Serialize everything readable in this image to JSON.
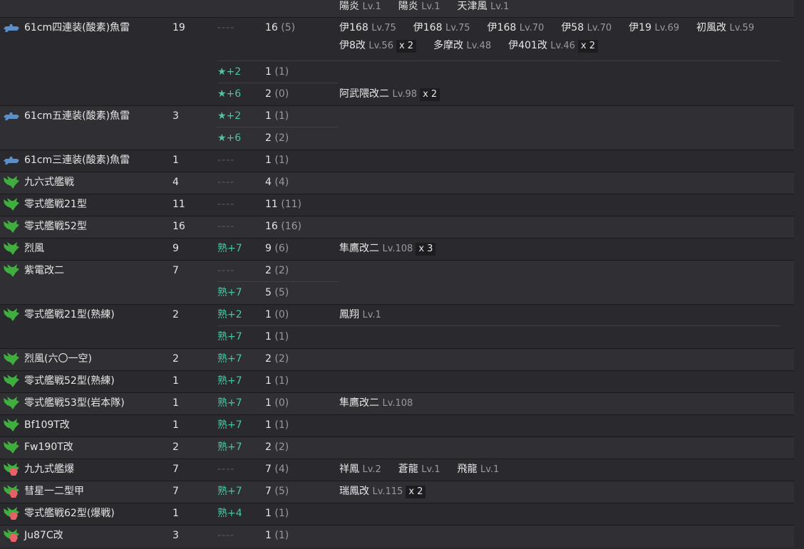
{
  "top_ships": [
    {
      "name": "陽炎",
      "lv": "Lv.1",
      "mult": ""
    },
    {
      "name": "陽炎",
      "lv": "Lv.1",
      "mult": ""
    },
    {
      "name": "天津風",
      "lv": "Lv.1",
      "mult": ""
    }
  ],
  "equipment": [
    {
      "name": "61cm四連装(酸素)魚雷",
      "total": "19",
      "icon": "torpedo-icon",
      "subrows": [
        {
          "level": "----",
          "count": "16",
          "avail": "(5)",
          "ships": [
            [
              {
                "name": "伊168",
                "lv": "Lv.75",
                "mult": ""
              },
              {
                "name": "伊168",
                "lv": "Lv.75",
                "mult": ""
              },
              {
                "name": "伊168",
                "lv": "Lv.70",
                "mult": ""
              },
              {
                "name": "伊58",
                "lv": "Lv.70",
                "mult": ""
              },
              {
                "name": "伊19",
                "lv": "Lv.69",
                "mult": ""
              },
              {
                "name": "初風改",
                "lv": "Lv.59",
                "mult": ""
              }
            ],
            [
              {
                "name": "伊8改",
                "lv": "Lv.56",
                "mult": "x 2"
              },
              {
                "name": "多摩改",
                "lv": "Lv.48",
                "mult": ""
              },
              {
                "name": "伊401改",
                "lv": "Lv.46",
                "mult": "x 2"
              }
            ]
          ]
        },
        {
          "level": "★+2",
          "count": "1",
          "avail": "(1)",
          "ships": []
        },
        {
          "level": "★+6",
          "count": "2",
          "avail": "(0)",
          "ships": [
            [
              {
                "name": "阿武隈改二",
                "lv": "Lv.98",
                "mult": "x 2"
              }
            ]
          ]
        }
      ]
    },
    {
      "name": "61cm五連装(酸素)魚雷",
      "total": "3",
      "icon": "torpedo-icon",
      "subrows": [
        {
          "level": "★+2",
          "count": "1",
          "avail": "(1)",
          "ships": []
        },
        {
          "level": "★+6",
          "count": "2",
          "avail": "(2)",
          "ships": []
        }
      ]
    },
    {
      "name": "61cm三連装(酸素)魚雷",
      "total": "1",
      "icon": "torpedo-icon",
      "subrows": [
        {
          "level": "----",
          "count": "1",
          "avail": "(1)",
          "ships": []
        }
      ]
    },
    {
      "name": "九六式艦戦",
      "total": "4",
      "icon": "fighter-icon",
      "subrows": [
        {
          "level": "----",
          "count": "4",
          "avail": "(4)",
          "ships": []
        }
      ]
    },
    {
      "name": "零式艦戦21型",
      "total": "11",
      "icon": "fighter-icon",
      "subrows": [
        {
          "level": "----",
          "count": "11",
          "avail": "(11)",
          "ships": []
        }
      ]
    },
    {
      "name": "零式艦戦52型",
      "total": "16",
      "icon": "fighter-icon",
      "subrows": [
        {
          "level": "----",
          "count": "16",
          "avail": "(16)",
          "ships": []
        }
      ]
    },
    {
      "name": "烈風",
      "total": "9",
      "icon": "fighter-icon",
      "subrows": [
        {
          "level": "熟+7",
          "count": "9",
          "avail": "(6)",
          "ships": [
            [
              {
                "name": "隼鷹改二",
                "lv": "Lv.108",
                "mult": "x 3"
              }
            ]
          ]
        }
      ]
    },
    {
      "name": "紫電改二",
      "total": "7",
      "icon": "fighter-icon",
      "subrows": [
        {
          "level": "----",
          "count": "2",
          "avail": "(2)",
          "ships": []
        },
        {
          "level": "熟+7",
          "count": "5",
          "avail": "(5)",
          "ships": []
        }
      ]
    },
    {
      "name": "零式艦戦21型(熟練)",
      "total": "2",
      "icon": "fighter-icon",
      "subrows": [
        {
          "level": "熟+2",
          "count": "1",
          "avail": "(0)",
          "ships": [
            [
              {
                "name": "鳳翔",
                "lv": "Lv.1",
                "mult": ""
              }
            ]
          ]
        },
        {
          "level": "熟+7",
          "count": "1",
          "avail": "(1)",
          "ships": []
        }
      ]
    },
    {
      "name": "烈風(六〇一空)",
      "total": "2",
      "icon": "fighter-icon",
      "subrows": [
        {
          "level": "熟+7",
          "count": "2",
          "avail": "(2)",
          "ships": []
        }
      ]
    },
    {
      "name": "零式艦戦52型(熟練)",
      "total": "1",
      "icon": "fighter-icon",
      "subrows": [
        {
          "level": "熟+7",
          "count": "1",
          "avail": "(1)",
          "ships": []
        }
      ]
    },
    {
      "name": "零式艦戦53型(岩本隊)",
      "total": "1",
      "icon": "fighter-icon",
      "subrows": [
        {
          "level": "熟+7",
          "count": "1",
          "avail": "(0)",
          "ships": [
            [
              {
                "name": "隼鷹改二",
                "lv": "Lv.108",
                "mult": ""
              }
            ]
          ]
        }
      ]
    },
    {
      "name": "Bf109T改",
      "total": "1",
      "icon": "fighter-icon",
      "subrows": [
        {
          "level": "熟+7",
          "count": "1",
          "avail": "(1)",
          "ships": []
        }
      ]
    },
    {
      "name": "Fw190T改",
      "total": "2",
      "icon": "fighter-icon",
      "subrows": [
        {
          "level": "熟+7",
          "count": "2",
          "avail": "(2)",
          "ships": []
        }
      ]
    },
    {
      "name": "九九式艦爆",
      "total": "7",
      "icon": "dive-bomber-icon",
      "subrows": [
        {
          "level": "----",
          "count": "7",
          "avail": "(4)",
          "ships": [
            [
              {
                "name": "祥鳳",
                "lv": "Lv.2",
                "mult": ""
              },
              {
                "name": "蒼龍",
                "lv": "Lv.1",
                "mult": ""
              },
              {
                "name": "飛龍",
                "lv": "Lv.1",
                "mult": ""
              }
            ]
          ]
        }
      ]
    },
    {
      "name": "彗星一二型甲",
      "total": "7",
      "icon": "dive-bomber-icon",
      "subrows": [
        {
          "level": "熟+7",
          "count": "7",
          "avail": "(5)",
          "ships": [
            [
              {
                "name": "瑞鳳改",
                "lv": "Lv.115",
                "mult": "x 2"
              }
            ]
          ]
        }
      ]
    },
    {
      "name": "零式艦戦62型(爆戦)",
      "total": "1",
      "icon": "dive-bomber-icon",
      "subrows": [
        {
          "level": "熟+4",
          "count": "1",
          "avail": "(1)",
          "ships": []
        }
      ]
    },
    {
      "name": "Ju87C改",
      "total": "3",
      "icon": "dive-bomber-icon",
      "subrows": [
        {
          "level": "----",
          "count": "1",
          "avail": "(1)",
          "ships": []
        }
      ]
    }
  ],
  "colors": {
    "background": "#2a2a2e",
    "proficiency": "#4fc3a6",
    "torpedo_icon": "#5b8fc7",
    "fighter_icon": "#3fae3f",
    "bomber_icon": "#e8606a"
  }
}
